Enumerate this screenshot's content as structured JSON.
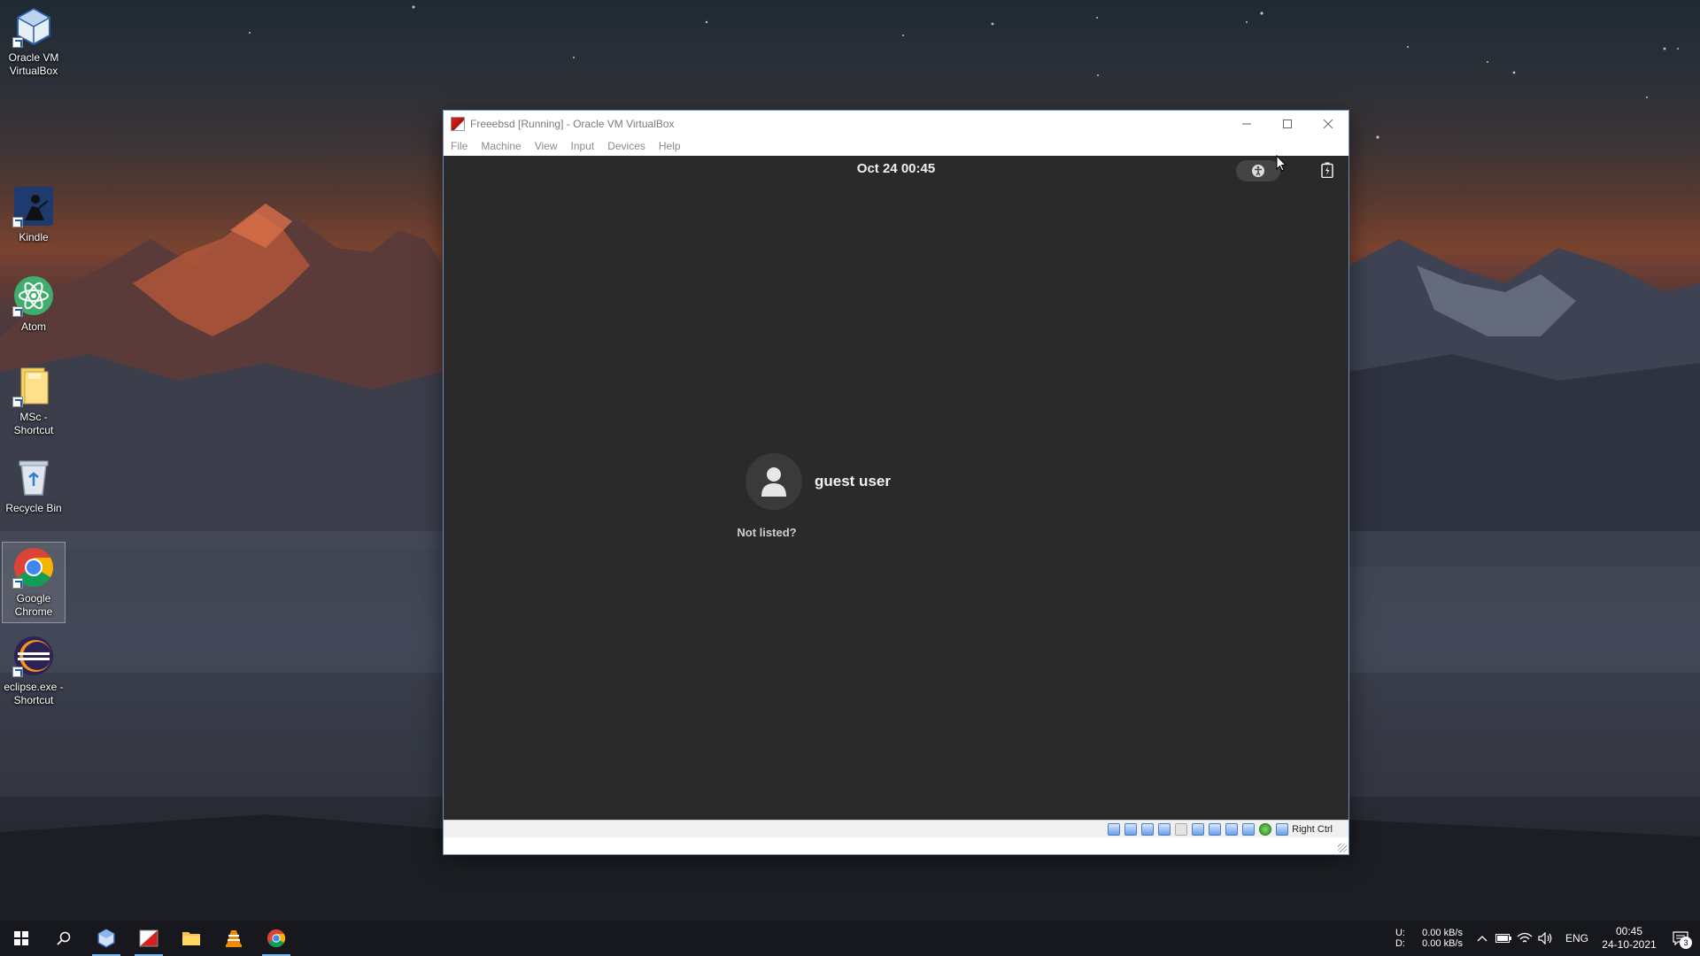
{
  "desktop": {
    "icons": [
      {
        "label": "Oracle VM VirtualBox",
        "icon": "virtualbox-icon"
      },
      {
        "label": "Kindle",
        "icon": "kindle-icon"
      },
      {
        "label": "Atom",
        "icon": "atom-icon"
      },
      {
        "label": "MSc - Shortcut",
        "icon": "folder-icon"
      },
      {
        "label": "Recycle Bin",
        "icon": "recycle-bin-icon"
      },
      {
        "label": "Google Chrome",
        "icon": "chrome-icon"
      },
      {
        "label": "eclipse.exe - Shortcut",
        "icon": "eclipse-icon"
      }
    ]
  },
  "window": {
    "title": "Freeebsd [Running] - Oracle VM VirtualBox",
    "menu": [
      "File",
      "Machine",
      "View",
      "Input",
      "Devices",
      "Help"
    ]
  },
  "vm": {
    "clock": "Oct 24  00:45",
    "user_name": "guest user",
    "not_listed": "Not listed?",
    "host_key": "Right Ctrl"
  },
  "taskbar": {
    "net_upload_label": "U:",
    "net_download_label": "D:",
    "net_upload": "0.00 kB/s",
    "net_download": "0.00 kB/s",
    "language": "ENG",
    "time": "00:45",
    "date": "24-10-2021",
    "notification_count": "3"
  },
  "colors": {
    "taskbar_bg": "#16181d",
    "vm_bg": "#2a2a2a",
    "accent": "#76b9ed"
  }
}
